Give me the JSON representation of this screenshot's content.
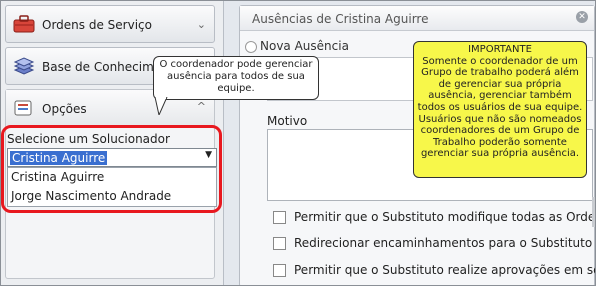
{
  "sidebar": {
    "items": [
      {
        "label": "Ordens de Serviço",
        "icon": "toolbox-icon"
      },
      {
        "label": "Base de Conhecimento",
        "icon": "stacked-books-icon"
      }
    ],
    "options": {
      "label": "Opções",
      "icon": "settings-icon",
      "select_label": "Selecione um Solucionador",
      "selected_value": "Cristina Aguirre",
      "dropdown_items": [
        "Cristina Aguirre",
        "Jorge Nascimento Andrade"
      ]
    }
  },
  "callouts": {
    "left": "O coordenador pode gerenciar ausência para todos de sua equipe.",
    "right_title": "IMPORTANTE",
    "right_body": "Somente o coordenador de um Grupo de trabalho poderá além de gerenciar sua própria ausência, gerenciar também todos os usuários de sua equipe. Usuários que não são nomeados coordenadores de um Grupo de Trabalho poderão somente gerenciar sua própria ausência."
  },
  "main": {
    "title": "Ausências de Cristina Aguirre",
    "new_absence_tab": "Nova Ausência",
    "motivo_label": "Motivo",
    "checkboxes": [
      "Permitir que o Substituto modifique todas as Ordens de",
      "Redirecionar encaminhamentos para o Substituto",
      "Permitir que o Substituto realize aprovações em seu"
    ]
  },
  "colors": {
    "highlight": "#e8181f",
    "callout_yellow": "#f7f74a",
    "selection": "#3a6fd0"
  }
}
